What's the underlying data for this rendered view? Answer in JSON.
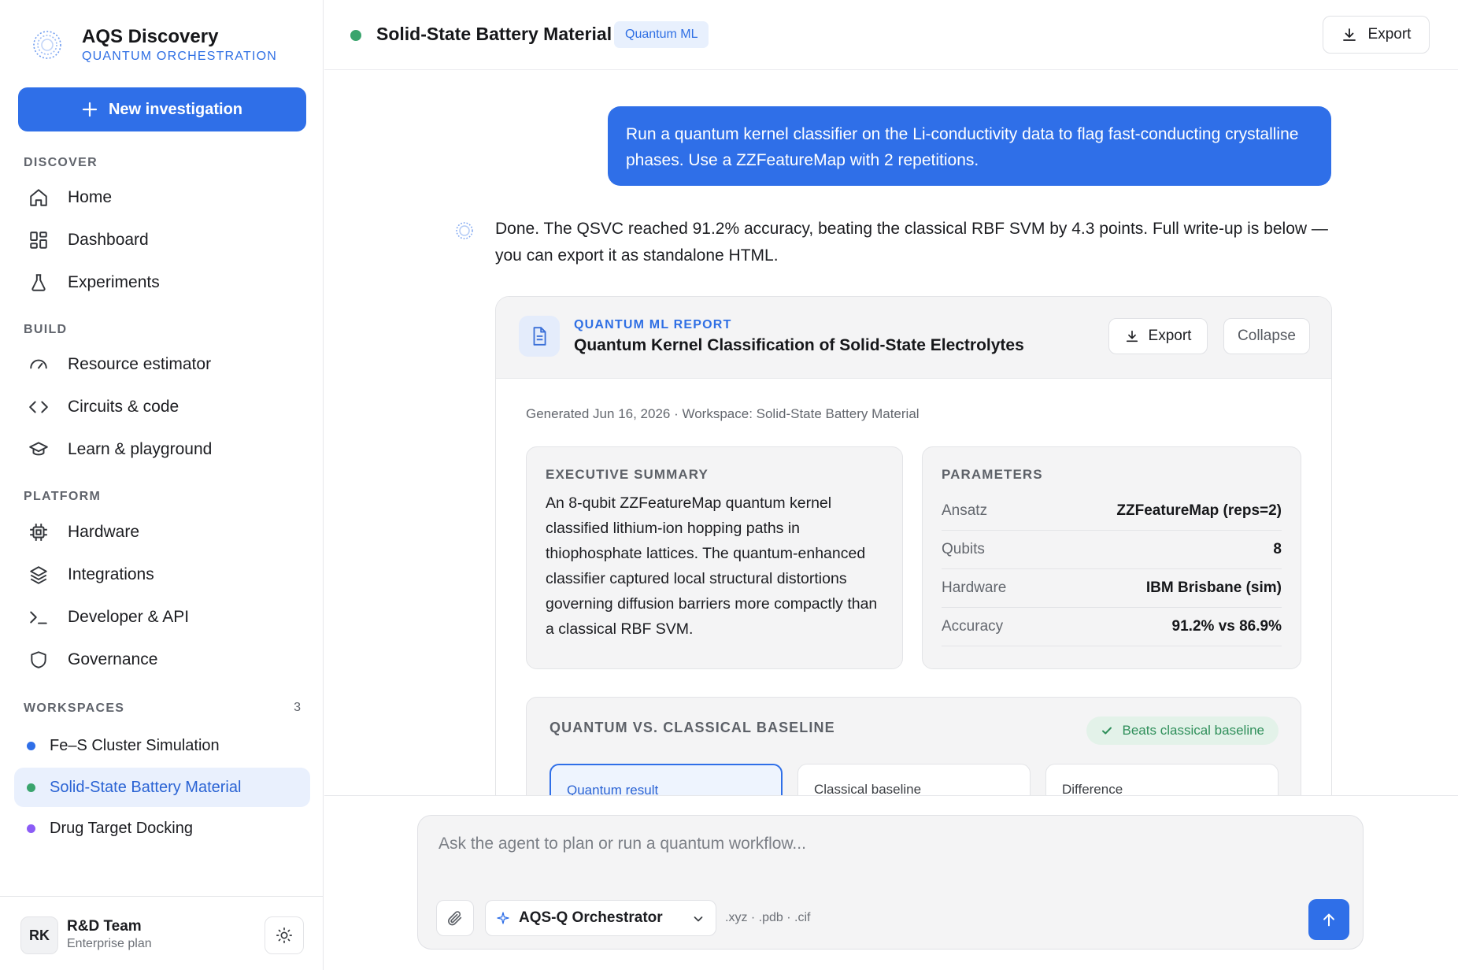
{
  "brand": {
    "name": "AQS Discovery",
    "tagline": "QUANTUM ORCHESTRATION"
  },
  "sidebar": {
    "new_button": "New investigation",
    "sections": {
      "discover": "DISCOVER",
      "build": "BUILD",
      "platform": "PLATFORM",
      "workspaces": "WORKSPACES"
    },
    "discover_items": [
      {
        "label": "Home",
        "icon": "home-icon"
      },
      {
        "label": "Dashboard",
        "icon": "dashboard-icon"
      },
      {
        "label": "Experiments",
        "icon": "flask-icon"
      }
    ],
    "build_items": [
      {
        "label": "Resource estimator",
        "icon": "gauge-icon"
      },
      {
        "label": "Circuits & code",
        "icon": "code-icon"
      },
      {
        "label": "Learn & playground",
        "icon": "graduation-cap-icon"
      }
    ],
    "platform_items": [
      {
        "label": "Hardware",
        "icon": "chip-icon"
      },
      {
        "label": "Integrations",
        "icon": "layers-icon"
      },
      {
        "label": "Developer & API",
        "icon": "terminal-icon"
      },
      {
        "label": "Governance",
        "icon": "shield-icon"
      }
    ],
    "workspace_count": "3",
    "workspaces": [
      {
        "label": "Fe–S Cluster Simulation",
        "color": "#2f6fe8"
      },
      {
        "label": "Solid-State Battery Material",
        "color": "#3aa46d",
        "active": true
      },
      {
        "label": "Drug Target Docking",
        "color": "#8b5cf6"
      }
    ],
    "user": {
      "initials": "RK",
      "name": "R&D Team",
      "plan": "Enterprise plan"
    }
  },
  "header": {
    "title": "Solid-State Battery Material",
    "tag": "Quantum ML",
    "export_label": "Export",
    "status_color": "#3aa46d"
  },
  "chat": {
    "user_message": "Run a quantum kernel classifier on the Li-conductivity data to flag fast-conducting crystalline phases. Use a ZZFeatureMap with 2 repetitions.",
    "agent_message": "Done. The QSVC reached 91.2% accuracy, beating the classical RBF SVM by 4.3 points. Full write-up is below — you can export it as standalone HTML."
  },
  "report": {
    "eyebrow": "QUANTUM ML REPORT",
    "title": "Quantum Kernel Classification of Solid-State Electrolytes",
    "export_label": "Export",
    "collapse_label": "Collapse",
    "generated": "Generated Jun 16, 2026 · Workspace: Solid-State Battery Material",
    "summary": {
      "label": "EXECUTIVE SUMMARY",
      "text": "An 8-qubit ZZFeatureMap quantum kernel classified lithium-ion hopping paths in thiophosphate lattices. The quantum-enhanced classifier captured local structural distortions governing diffusion barriers more compactly than a classical RBF SVM."
    },
    "parameters": {
      "label": "PARAMETERS",
      "rows": [
        {
          "key": "Ansatz",
          "value": "ZZFeatureMap (reps=2)"
        },
        {
          "key": "Qubits",
          "value": "8"
        },
        {
          "key": "Hardware",
          "value": "IBM Brisbane (sim)"
        },
        {
          "key": "Accuracy",
          "value": "91.2% vs 86.9%"
        }
      ]
    },
    "baseline": {
      "label": "QUANTUM VS. CLASSICAL BASELINE",
      "badge": "Beats classical baseline",
      "metrics": [
        "Quantum result",
        "Classical baseline",
        "Difference"
      ]
    }
  },
  "composer": {
    "placeholder": "Ask the agent to plan or run a quantum workflow...",
    "model": "AQS-Q Orchestrator",
    "formats": ".xyz · .pdb · .cif"
  },
  "colors": {
    "accent": "#2f6fe8",
    "success": "#3aa46d",
    "violet": "#8b5cf6"
  }
}
